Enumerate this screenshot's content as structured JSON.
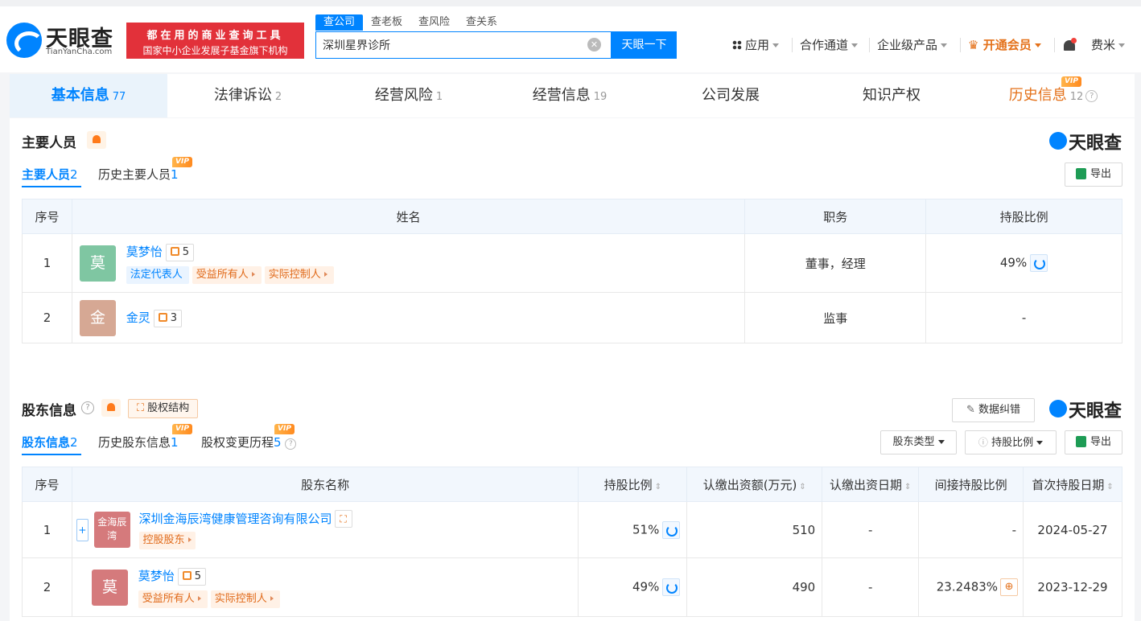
{
  "header": {
    "logo_text": "天眼查",
    "logo_sub": "TianYanCha.com",
    "slogan_line1": "都在用的商业查询工具",
    "slogan_line2": "国家中小企业发展子基金旗下机构",
    "search_tabs": [
      "查公司",
      "查老板",
      "查风险",
      "查关系"
    ],
    "search_value": "深圳星界诊所",
    "search_button": "天眼一下",
    "nav": {
      "apps": "应用",
      "partner": "合作通道",
      "enterprise": "企业级产品",
      "vip": "开通会员",
      "user": "费米"
    }
  },
  "tabs": [
    {
      "label": "基本信息",
      "count": "77"
    },
    {
      "label": "法律诉讼",
      "count": "2"
    },
    {
      "label": "经营风险",
      "count": "1"
    },
    {
      "label": "经营信息",
      "count": "19"
    },
    {
      "label": "公司发展",
      "count": ""
    },
    {
      "label": "知识产权",
      "count": ""
    },
    {
      "label": "历史信息",
      "count": "12"
    }
  ],
  "vip_label": "VIP",
  "personnel": {
    "title": "主要人员",
    "watermark": "天眼查",
    "subtabs": [
      {
        "label": "主要人员",
        "count": "2"
      },
      {
        "label": "历史主要人员",
        "count": "1"
      }
    ],
    "export": "导出",
    "columns": [
      "序号",
      "姓名",
      "职务",
      "持股比例"
    ],
    "rows": [
      {
        "no": "1",
        "avatar": "莫",
        "name": "莫梦怡",
        "tree": "5",
        "tags": [
          "法定代表人",
          "受益所有人",
          "实际控制人"
        ],
        "role": "董事，经理",
        "ratio": "49%"
      },
      {
        "no": "2",
        "avatar": "金",
        "name": "金灵",
        "tree": "3",
        "tags": [],
        "role": "监事",
        "ratio": "-"
      }
    ]
  },
  "shareholders": {
    "title": "股东信息",
    "equity_button": "股权结构",
    "correction": "数据纠错",
    "watermark": "天眼查",
    "subtabs": [
      {
        "label": "股东信息",
        "count": "2"
      },
      {
        "label": "历史股东信息",
        "count": "1"
      },
      {
        "label": "股权变更历程",
        "count": "5"
      }
    ],
    "filter_type": "股东类型",
    "filter_ratio": "持股比例",
    "export": "导出",
    "columns": [
      "序号",
      "股东名称",
      "持股比例",
      "认缴出资额(万元)",
      "认缴出资日期",
      "间接持股比例",
      "首次持股日期"
    ],
    "rows": [
      {
        "no": "1",
        "avatar": "金海辰湾",
        "name": "深圳金海辰湾健康管理咨询有限公司",
        "tree": "",
        "tags": [
          "控股股东"
        ],
        "ratio": "51%",
        "amount": "510",
        "date": "-",
        "indirect": "-",
        "first_date": "2024-05-27"
      },
      {
        "no": "2",
        "avatar": "莫",
        "name": "莫梦怡",
        "tree": "5",
        "tags": [
          "受益所有人",
          "实际控制人"
        ],
        "ratio": "49%",
        "amount": "490",
        "date": "-",
        "indirect": "23.2483%",
        "first_date": "2023-12-29"
      }
    ]
  },
  "colors": {
    "brand": "#0084ff",
    "vip_orange": "#f08a24",
    "slogan_red": "#e2313a",
    "avatar_green": "#7fc6a2",
    "avatar_tan": "#d6a894",
    "avatar_red": "#d57a7c"
  }
}
